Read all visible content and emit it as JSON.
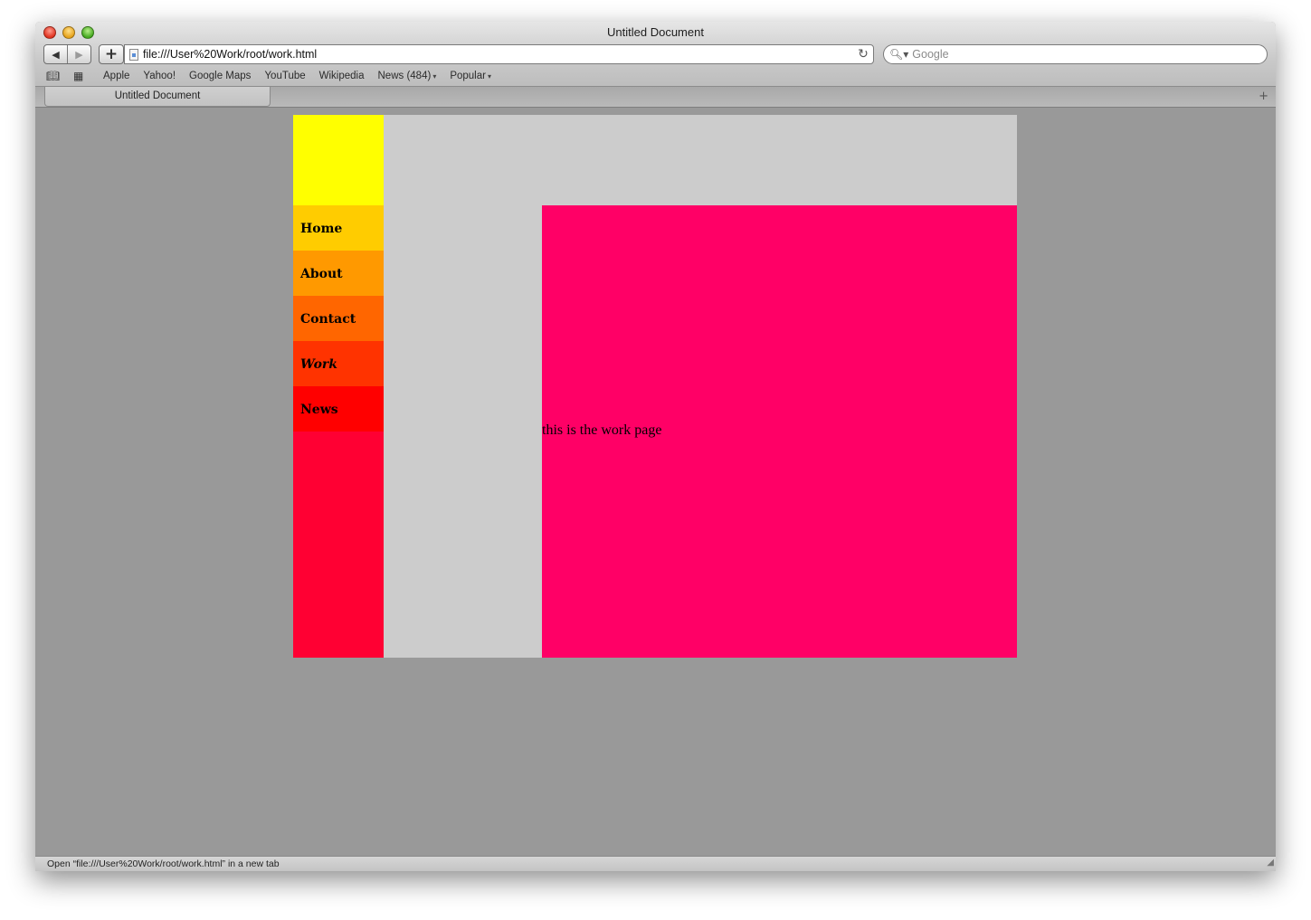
{
  "window": {
    "title": "Untitled Document"
  },
  "toolbar": {
    "back_icon": "◀",
    "forward_icon": "▶",
    "add_icon": "+",
    "url": "file:///User%20Work/root/work.html",
    "reload_icon": "↻",
    "search_placeholder": "Google",
    "search_icon": "🔍︎▾"
  },
  "bookmarks": {
    "book_icon": "📖︎",
    "grid_icon": "▦",
    "items": [
      "Apple",
      "Yahoo!",
      "Google Maps",
      "YouTube",
      "Wikipedia",
      "News (484)",
      "Popular"
    ],
    "caret": "▾"
  },
  "tabs": {
    "items": [
      "Untitled Document"
    ],
    "new_tab_icon": "+"
  },
  "page": {
    "nav": [
      {
        "label": "Home",
        "color": "#ffcc00"
      },
      {
        "label": "About",
        "color": "#ff9900"
      },
      {
        "label": "Contact",
        "color": "#ff6600"
      },
      {
        "label": "Work",
        "color": "#ff3300",
        "active": true
      },
      {
        "label": "News",
        "color": "#ff0000"
      }
    ],
    "main_text": "this is the work page",
    "colors": {
      "header_block": "#ffff00",
      "sidebar": "#ff0033",
      "main_panel": "#ff0066",
      "container": "#cccccc",
      "background": "#999999"
    }
  },
  "status": {
    "text": "Open “file:///User%20Work/root/work.html” in a new tab",
    "grip_icon": "◢"
  }
}
